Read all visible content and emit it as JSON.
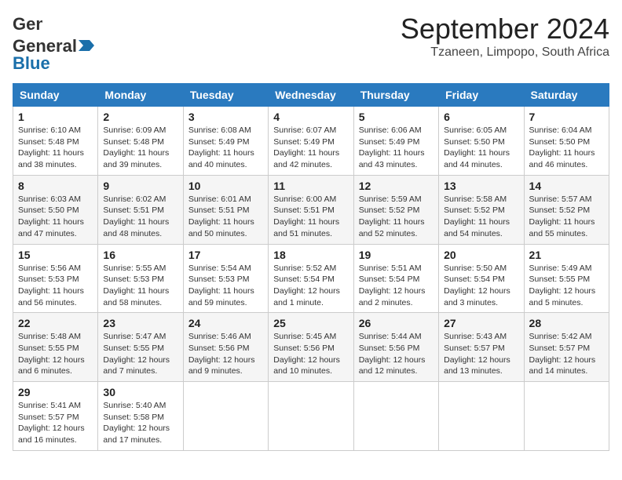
{
  "header": {
    "logo_general": "General",
    "logo_blue": "Blue",
    "month": "September 2024",
    "location": "Tzaneen, Limpopo, South Africa"
  },
  "weekdays": [
    "Sunday",
    "Monday",
    "Tuesday",
    "Wednesday",
    "Thursday",
    "Friday",
    "Saturday"
  ],
  "weeks": [
    [
      {
        "day": 1,
        "sunrise": "6:10 AM",
        "sunset": "5:48 PM",
        "daylight": "11 hours and 38 minutes."
      },
      {
        "day": 2,
        "sunrise": "6:09 AM",
        "sunset": "5:48 PM",
        "daylight": "11 hours and 39 minutes."
      },
      {
        "day": 3,
        "sunrise": "6:08 AM",
        "sunset": "5:49 PM",
        "daylight": "11 hours and 40 minutes."
      },
      {
        "day": 4,
        "sunrise": "6:07 AM",
        "sunset": "5:49 PM",
        "daylight": "11 hours and 42 minutes."
      },
      {
        "day": 5,
        "sunrise": "6:06 AM",
        "sunset": "5:49 PM",
        "daylight": "11 hours and 43 minutes."
      },
      {
        "day": 6,
        "sunrise": "6:05 AM",
        "sunset": "5:50 PM",
        "daylight": "11 hours and 44 minutes."
      },
      {
        "day": 7,
        "sunrise": "6:04 AM",
        "sunset": "5:50 PM",
        "daylight": "11 hours and 46 minutes."
      }
    ],
    [
      {
        "day": 8,
        "sunrise": "6:03 AM",
        "sunset": "5:50 PM",
        "daylight": "11 hours and 47 minutes."
      },
      {
        "day": 9,
        "sunrise": "6:02 AM",
        "sunset": "5:51 PM",
        "daylight": "11 hours and 48 minutes."
      },
      {
        "day": 10,
        "sunrise": "6:01 AM",
        "sunset": "5:51 PM",
        "daylight": "11 hours and 50 minutes."
      },
      {
        "day": 11,
        "sunrise": "6:00 AM",
        "sunset": "5:51 PM",
        "daylight": "11 hours and 51 minutes."
      },
      {
        "day": 12,
        "sunrise": "5:59 AM",
        "sunset": "5:52 PM",
        "daylight": "11 hours and 52 minutes."
      },
      {
        "day": 13,
        "sunrise": "5:58 AM",
        "sunset": "5:52 PM",
        "daylight": "11 hours and 54 minutes."
      },
      {
        "day": 14,
        "sunrise": "5:57 AM",
        "sunset": "5:52 PM",
        "daylight": "11 hours and 55 minutes."
      }
    ],
    [
      {
        "day": 15,
        "sunrise": "5:56 AM",
        "sunset": "5:53 PM",
        "daylight": "11 hours and 56 minutes."
      },
      {
        "day": 16,
        "sunrise": "5:55 AM",
        "sunset": "5:53 PM",
        "daylight": "11 hours and 58 minutes."
      },
      {
        "day": 17,
        "sunrise": "5:54 AM",
        "sunset": "5:53 PM",
        "daylight": "11 hours and 59 minutes."
      },
      {
        "day": 18,
        "sunrise": "5:52 AM",
        "sunset": "5:54 PM",
        "daylight": "12 hours and 1 minute."
      },
      {
        "day": 19,
        "sunrise": "5:51 AM",
        "sunset": "5:54 PM",
        "daylight": "12 hours and 2 minutes."
      },
      {
        "day": 20,
        "sunrise": "5:50 AM",
        "sunset": "5:54 PM",
        "daylight": "12 hours and 3 minutes."
      },
      {
        "day": 21,
        "sunrise": "5:49 AM",
        "sunset": "5:55 PM",
        "daylight": "12 hours and 5 minutes."
      }
    ],
    [
      {
        "day": 22,
        "sunrise": "5:48 AM",
        "sunset": "5:55 PM",
        "daylight": "12 hours and 6 minutes."
      },
      {
        "day": 23,
        "sunrise": "5:47 AM",
        "sunset": "5:55 PM",
        "daylight": "12 hours and 7 minutes."
      },
      {
        "day": 24,
        "sunrise": "5:46 AM",
        "sunset": "5:56 PM",
        "daylight": "12 hours and 9 minutes."
      },
      {
        "day": 25,
        "sunrise": "5:45 AM",
        "sunset": "5:56 PM",
        "daylight": "12 hours and 10 minutes."
      },
      {
        "day": 26,
        "sunrise": "5:44 AM",
        "sunset": "5:56 PM",
        "daylight": "12 hours and 12 minutes."
      },
      {
        "day": 27,
        "sunrise": "5:43 AM",
        "sunset": "5:57 PM",
        "daylight": "12 hours and 13 minutes."
      },
      {
        "day": 28,
        "sunrise": "5:42 AM",
        "sunset": "5:57 PM",
        "daylight": "12 hours and 14 minutes."
      }
    ],
    [
      {
        "day": 29,
        "sunrise": "5:41 AM",
        "sunset": "5:57 PM",
        "daylight": "12 hours and 16 minutes."
      },
      {
        "day": 30,
        "sunrise": "5:40 AM",
        "sunset": "5:58 PM",
        "daylight": "12 hours and 17 minutes."
      },
      null,
      null,
      null,
      null,
      null
    ]
  ],
  "labels": {
    "sunrise": "Sunrise:",
    "sunset": "Sunset:",
    "daylight": "Daylight:"
  }
}
